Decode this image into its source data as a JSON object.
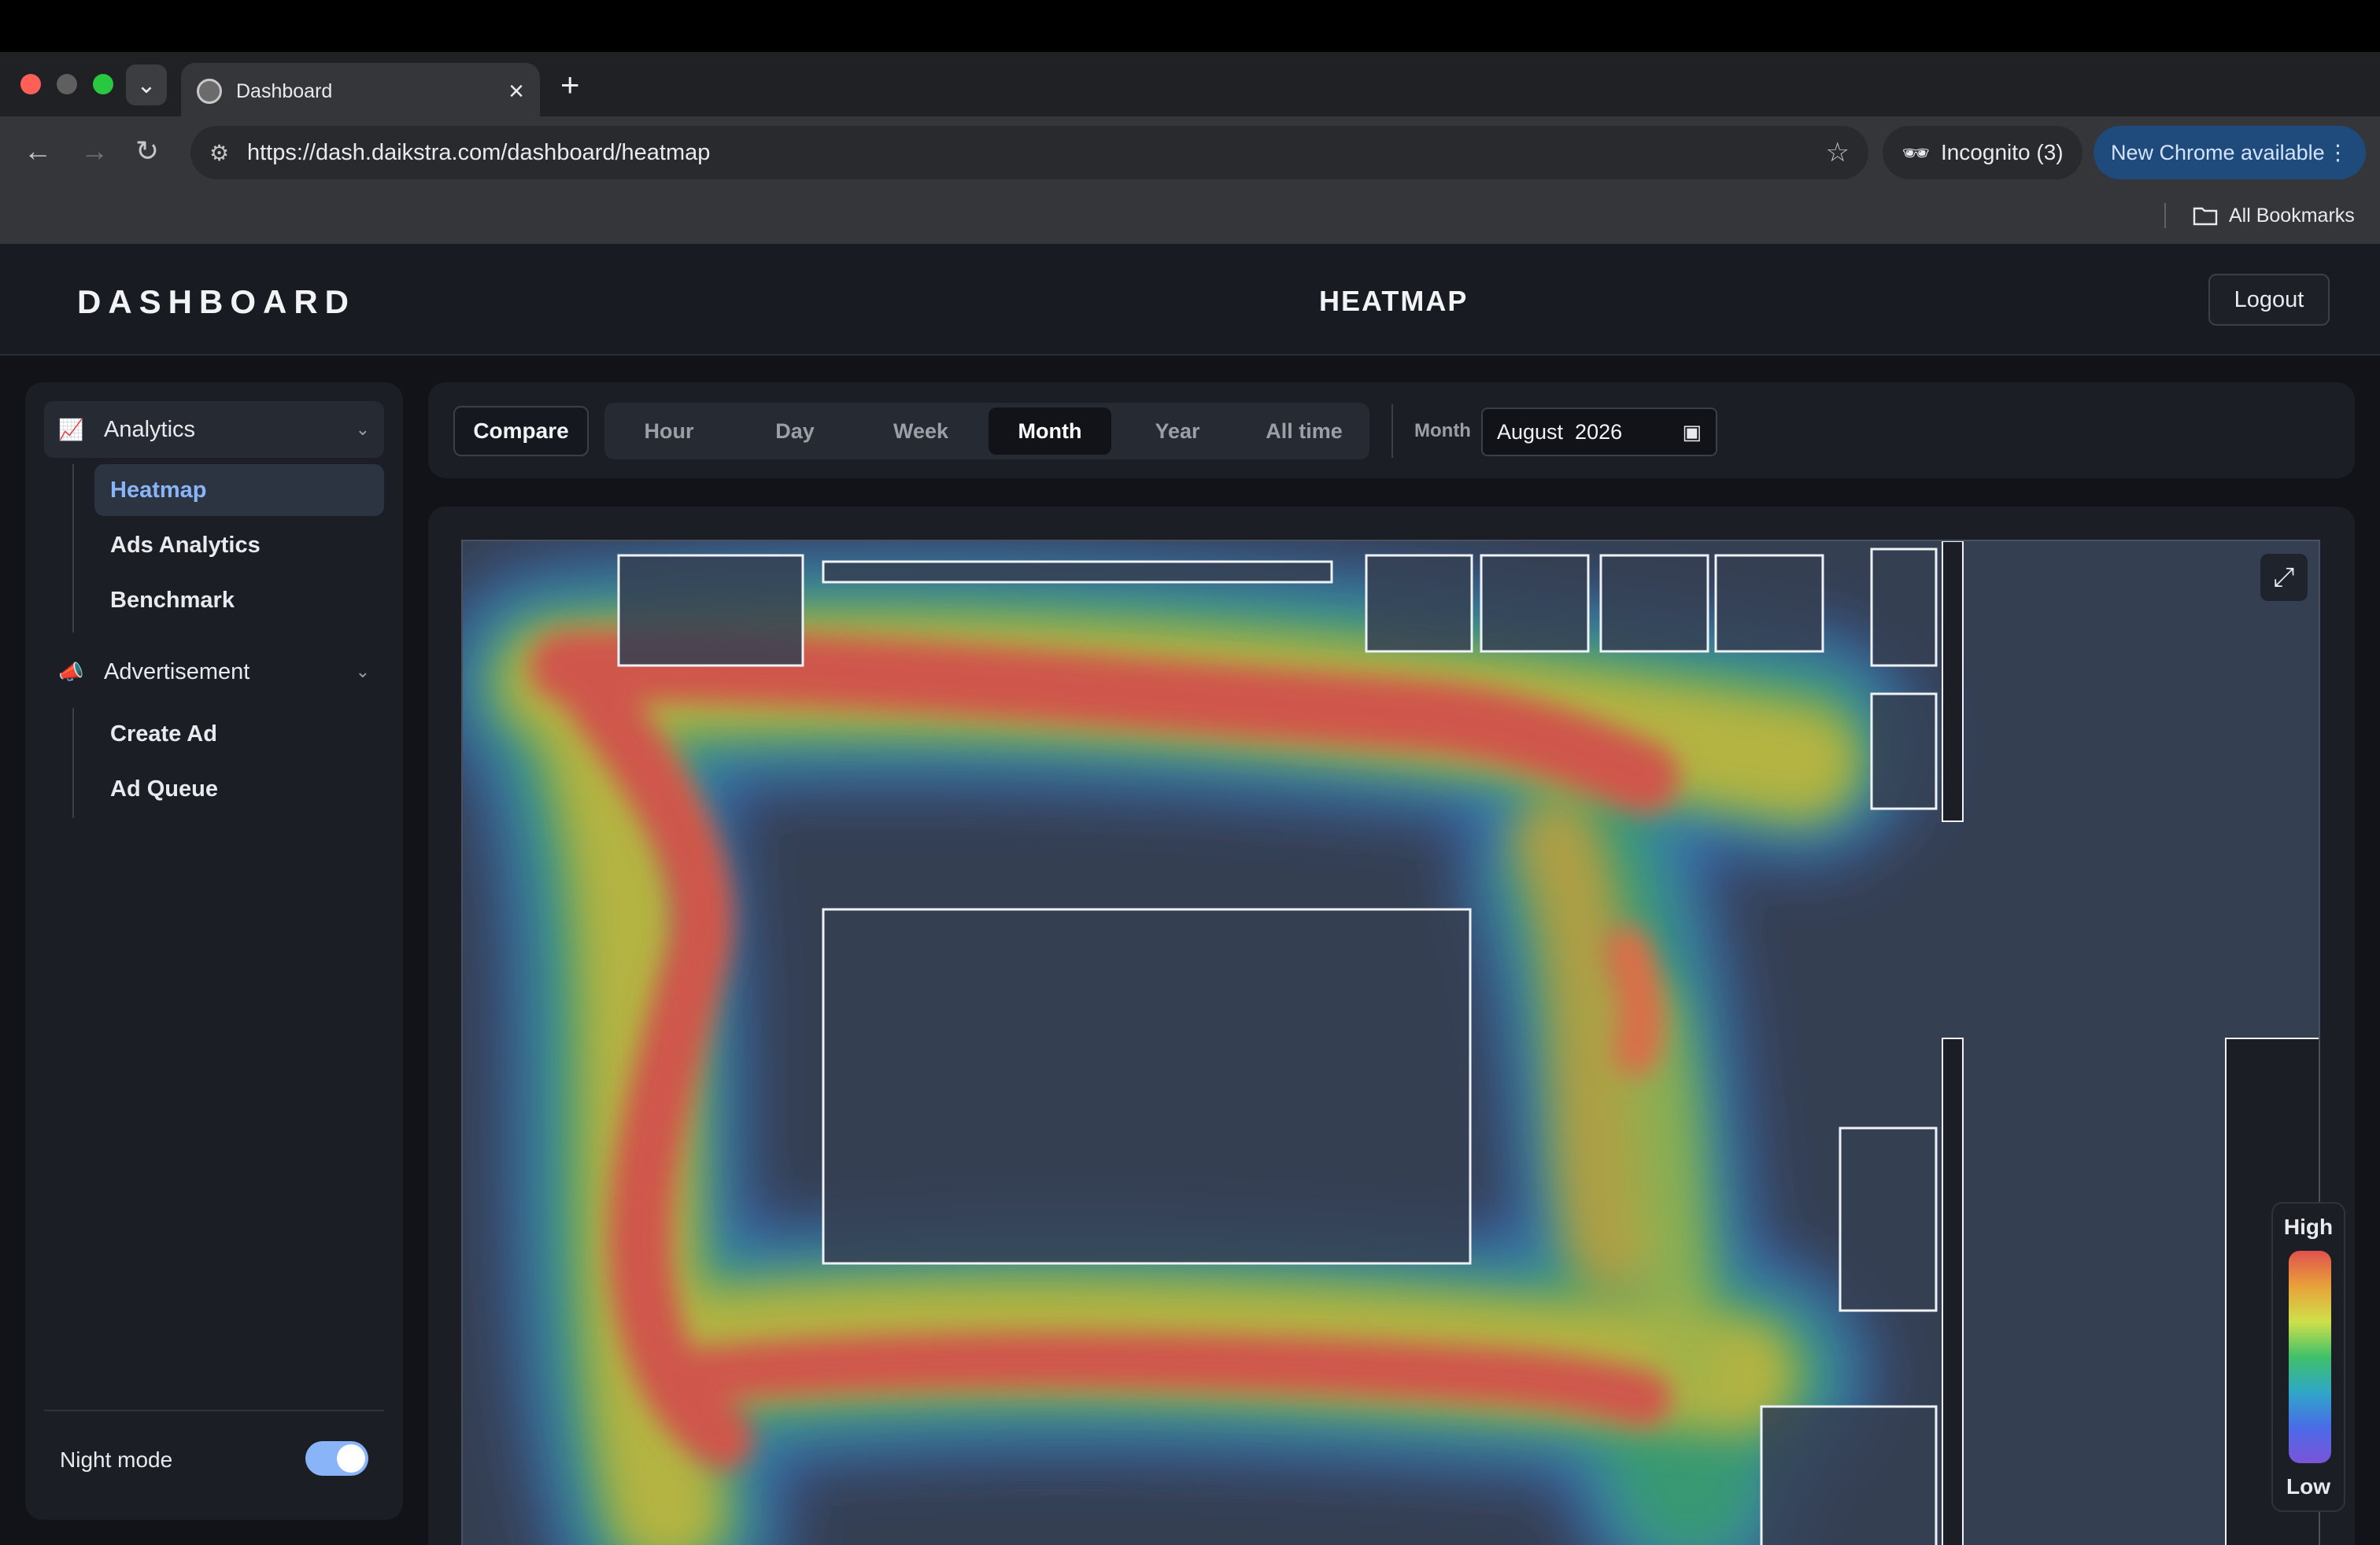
{
  "browser": {
    "tab_title": "Dashboard",
    "url": "https://dash.daikstra.com/dashboard/heatmap",
    "incognito_label": "Incognito (3)",
    "update_label": "New Chrome available",
    "bookmarks_label": "All Bookmarks",
    "icons": [
      "back-icon",
      "forward-icon",
      "reload-icon",
      "site-settings-icon",
      "star-icon",
      "incognito-icon",
      "more-icon",
      "folder-icon"
    ]
  },
  "header": {
    "brand": "DASHBOARD",
    "title": "HEATMAP",
    "logout_label": "Logout"
  },
  "sidebar": {
    "groups": [
      {
        "label": "Analytics",
        "icon": "analytics-chart-icon",
        "items": [
          "Heatmap",
          "Ads Analytics",
          "Benchmark"
        ],
        "active": "Heatmap"
      },
      {
        "label": "Advertisement",
        "icon": "megaphone-icon",
        "items": [
          "Create Ad",
          "Ad Queue"
        ]
      }
    ],
    "night_mode_label": "Night mode",
    "night_mode_on": true
  },
  "filters": {
    "compare_label": "Compare",
    "ranges": [
      "Hour",
      "Day",
      "Week",
      "Month",
      "Year",
      "All time"
    ],
    "selected_range": "Month",
    "month_label": "Month",
    "month_value": "August  2026"
  },
  "heatmap": {
    "legend_high": "High",
    "legend_low": "Low",
    "colors": {
      "high": "#e0524f",
      "mid": "#cfe04a",
      "low": "#7a54d8",
      "floor": "#353f52"
    }
  }
}
